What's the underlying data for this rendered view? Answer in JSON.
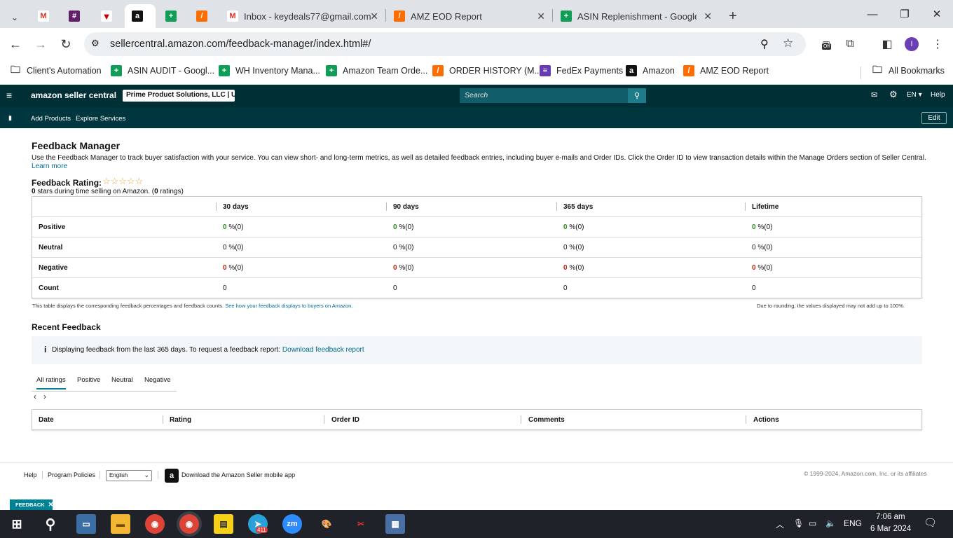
{
  "browser": {
    "tabs": [
      {
        "label": "",
        "icon": "gmail-icon"
      },
      {
        "label": "",
        "icon": "slack-icon"
      },
      {
        "label": "",
        "icon": "app-icon"
      },
      {
        "label": "",
        "icon": "amazon-icon"
      },
      {
        "label": "",
        "icon": "sheets-icon"
      },
      {
        "label": "",
        "icon": "zap-icon"
      },
      {
        "label": "Inbox - keydeals77@gmail.com",
        "icon": "gmail-icon"
      },
      {
        "label": "AMZ EOD Report",
        "icon": "zap-icon"
      },
      {
        "label": "ASIN Replenishment - Google S",
        "icon": "sheets-icon"
      }
    ],
    "new_tab": "+",
    "url": "sellercentral.amazon.com/feedback-manager/index.html#/",
    "profile_initial": "I",
    "ext_badge": "Off",
    "bookmarks": [
      {
        "label": "Client's Automation",
        "icon": "folder-icon"
      },
      {
        "label": "ASIN AUDIT - Googl...",
        "icon": "sheets-icon"
      },
      {
        "label": "WH Inventory Mana...",
        "icon": "sheets-icon"
      },
      {
        "label": "Amazon Team Orde...",
        "icon": "sheets-icon"
      },
      {
        "label": "ORDER HISTORY (M...",
        "icon": "zap-icon"
      },
      {
        "label": "FedEx Payments",
        "icon": "forms-icon"
      },
      {
        "label": "Amazon",
        "icon": "amazon-icon"
      },
      {
        "label": "AMZ EOD Report",
        "icon": "zap-icon"
      }
    ],
    "all_bookmarks": "All Bookmarks"
  },
  "seller": {
    "logo": "amazon seller central",
    "store": "Prime Product Solutions, LLC | U...",
    "search_placeholder": "Search",
    "lang": "EN",
    "help": "Help",
    "nav": [
      "Add Products",
      "Explore Services"
    ],
    "edit": "Edit"
  },
  "page": {
    "title": "Feedback Manager",
    "description": "Use the Feedback Manager to track buyer satisfaction with your service. You can view short- and long-term metrics, as well as detailed feedback entries, including buyer e-mails and Order IDs. Click the Order ID to view transaction details within the Manage Orders section of Seller Central.",
    "learn_more": "Learn more",
    "rating_label": "Feedback Rating:",
    "stars_text": "☆☆☆☆☆",
    "rating_value": "0",
    "rating_sub_mid": " stars during time selling on Amazon. (",
    "rating_count": "0",
    "rating_sub_end": " ratings)",
    "table": {
      "headers": [
        "30 days",
        "90 days",
        "365 days",
        "Lifetime"
      ],
      "rows": [
        {
          "label": "Positive",
          "cells": [
            [
              "0",
              " %(0)"
            ],
            [
              "0",
              " %(0)"
            ],
            [
              "0",
              " %(0)"
            ],
            [
              "0",
              " %(0)"
            ]
          ],
          "tone": "green"
        },
        {
          "label": "Neutral",
          "cells": [
            [
              "0",
              " %(0)"
            ],
            [
              "0",
              " %(0)"
            ],
            [
              "0",
              " %(0)"
            ],
            [
              "0",
              " %(0)"
            ]
          ],
          "tone": "plain"
        },
        {
          "label": "Negative",
          "cells": [
            [
              "0",
              " %(0)"
            ],
            [
              "0",
              " %(0)"
            ],
            [
              "0",
              " %(0)"
            ],
            [
              "0",
              " %(0)"
            ]
          ],
          "tone": "red"
        },
        {
          "label": "Count",
          "cells": [
            [
              "",
              "0"
            ],
            [
              "",
              "0"
            ],
            [
              "",
              "0"
            ],
            [
              "",
              "0"
            ]
          ],
          "tone": "plain"
        }
      ]
    },
    "note_left": "This table displays the corresponding feedback percentages and feedback counts. ",
    "note_link": "See how your feedback displays to buyers on Amazon.",
    "note_right": "Due to rounding, the values displayed may not add up to 100%.",
    "recent_title": "Recent Feedback",
    "info_text": "Displaying feedback from the last 365 days. To request a feedback report: ",
    "info_link": "Download feedback report",
    "rating_tabs": [
      "All ratings",
      "Positive",
      "Neutral",
      "Negative"
    ],
    "recent_headers": [
      "Date",
      "Rating",
      "Order ID",
      "Comments",
      "Actions"
    ]
  },
  "footer": {
    "help": "Help",
    "policies": "Program Policies",
    "language": "English",
    "app": "Download the Amazon Seller mobile app",
    "copyright": "© 1999-2024, Amazon.com, Inc. or its affiliates",
    "feedback_tag": "FEEDBACK"
  },
  "taskbar": {
    "telegram_badge": "411",
    "lang": "ENG",
    "time": "7:06 am",
    "date": "6 Mar 2024"
  },
  "colors": {
    "header": "#002f36",
    "accent": "#008296",
    "positive": "#2e8b19",
    "negative": "#b12704"
  }
}
